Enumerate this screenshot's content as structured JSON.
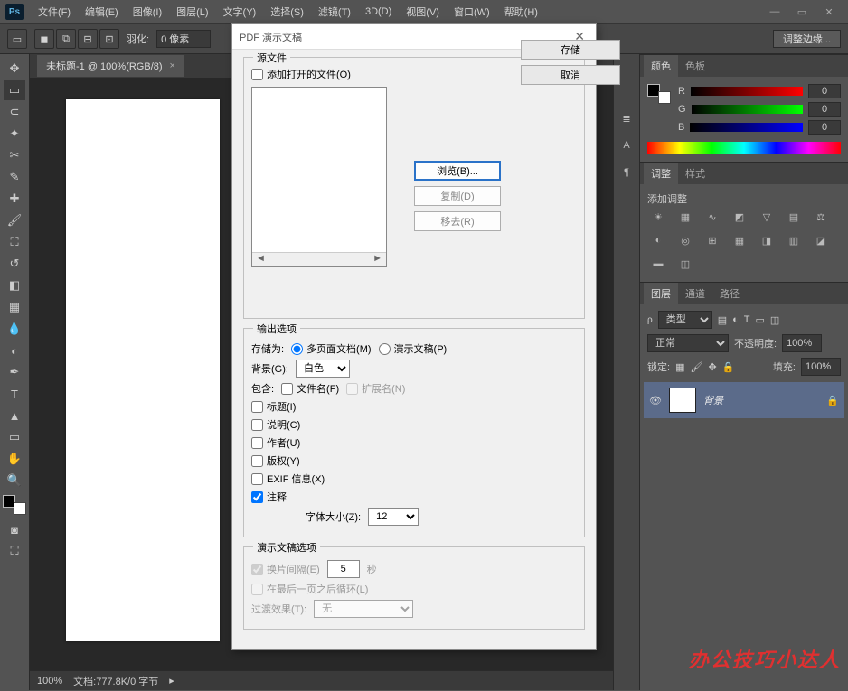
{
  "app": {
    "logo": "Ps"
  },
  "menu": [
    "文件(F)",
    "编辑(E)",
    "图像(I)",
    "图层(L)",
    "文字(Y)",
    "选择(S)",
    "滤镜(T)",
    "3D(D)",
    "视图(V)",
    "窗口(W)",
    "帮助(H)"
  ],
  "optbar": {
    "feather_label": "羽化:",
    "feather_value": "0 像素",
    "refine": "调整边缘..."
  },
  "doc": {
    "tab": "未标题-1 @ 100%(RGB/8)",
    "zoom": "100%",
    "status": "文档:777.8K/0 字节"
  },
  "dialog": {
    "title": "PDF 演示文稿",
    "save": "存储",
    "cancel": "取消",
    "src": {
      "legend": "源文件",
      "add_open": "添加打开的文件(O)",
      "browse": "浏览(B)...",
      "duplicate": "复制(D)",
      "remove": "移去(R)"
    },
    "out": {
      "legend": "输出选项",
      "saveas": "存储为:",
      "multipage": "多页面文档(M)",
      "presentation": "演示文稿(P)",
      "bg_label": "背景(G):",
      "bg_value": "白色",
      "include": "包含:",
      "filename": "文件名(F)",
      "ext": "扩展名(N)",
      "title": "标题(I)",
      "desc": "说明(C)",
      "author": "作者(U)",
      "copyright": "版权(Y)",
      "exif": "EXIF 信息(X)",
      "annot": "注释",
      "fontsize_label": "字体大小(Z):",
      "fontsize": "12"
    },
    "pres": {
      "legend": "演示文稿选项",
      "interval_label": "换片间隔(E)",
      "interval": "5",
      "seconds": "秒",
      "loop": "在最后一页之后循环(L)",
      "trans_label": "过渡效果(T):",
      "trans": "无"
    }
  },
  "panels": {
    "color": {
      "tab1": "颜色",
      "tab2": "色板",
      "r": "R",
      "g": "G",
      "b": "B",
      "val": "0"
    },
    "adjust": {
      "tab1": "调整",
      "tab2": "样式",
      "add": "添加调整"
    },
    "layers": {
      "tab1": "图层",
      "tab2": "通道",
      "tab3": "路径",
      "kind": "类型",
      "mode": "正常",
      "op_label": "不透明度:",
      "op": "100%",
      "lock": "锁定:",
      "fill_label": "填充:",
      "fill": "100%",
      "layer_name": "背景"
    }
  },
  "watermark": "办公技巧小达人"
}
